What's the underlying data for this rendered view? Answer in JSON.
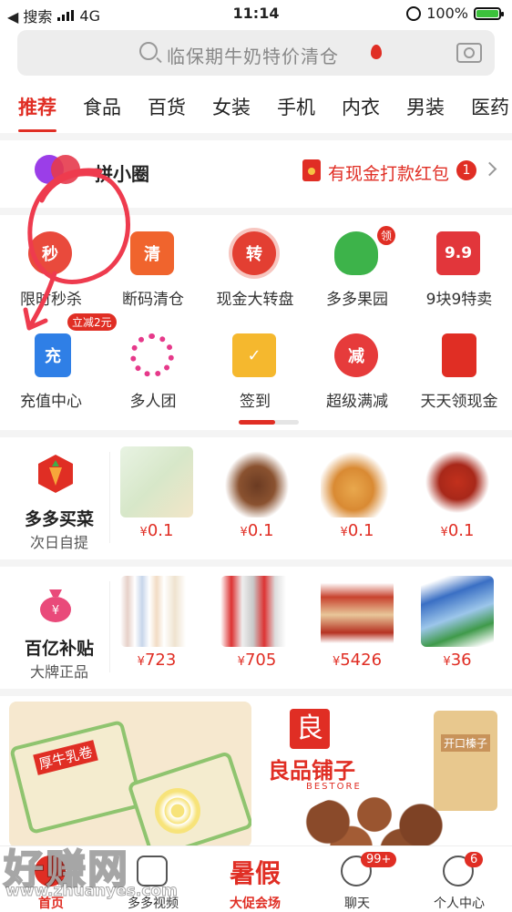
{
  "status": {
    "carrier": "◀ 搜索",
    "network": "4G",
    "time": "11:14",
    "battery": "100%"
  },
  "search": {
    "placeholder": "临保期牛奶特价清仓"
  },
  "categories": [
    "推荐",
    "食品",
    "百货",
    "女装",
    "手机",
    "内衣",
    "男装",
    "医药"
  ],
  "pin": {
    "title": "拼小圈",
    "promo": "有现金打款红包",
    "badge": "1"
  },
  "grid": [
    {
      "label": "限时秒杀",
      "icon": "alarm-clock-icon",
      "glyph": "秒",
      "color": "#e94a3c"
    },
    {
      "label": "断码清仓",
      "icon": "truck-icon",
      "glyph": "清",
      "color": "#f0642d"
    },
    {
      "label": "现金大转盘",
      "icon": "spin-wheel-icon",
      "glyph": "转",
      "color": "#e33f32"
    },
    {
      "label": "多多果园",
      "icon": "tree-icon",
      "glyph": "",
      "color": "#3db34a",
      "tag": "领"
    },
    {
      "label": "9块9特卖",
      "icon": "price-tag-icon",
      "glyph": "9.9",
      "color": "#e2363b"
    },
    {
      "label": "充值中心",
      "icon": "phone-recharge-icon",
      "glyph": "充",
      "color": "#2f7fe6",
      "tag": "立减2元"
    },
    {
      "label": "多人团",
      "icon": "group-icon",
      "glyph": "",
      "color": "#e6398a"
    },
    {
      "label": "签到",
      "icon": "calendar-check-icon",
      "glyph": "✓",
      "color": "#f5b82e"
    },
    {
      "label": "超级满减",
      "icon": "discount-icon",
      "glyph": "减",
      "color": "#e63b3b"
    },
    {
      "label": "天天领现金",
      "icon": "red-envelope-icon",
      "glyph": "",
      "color": "#e02e24"
    }
  ],
  "maicai": {
    "title": "多多买菜",
    "subtitle": "次日自提",
    "prices": [
      "0.1",
      "0.1",
      "0.1",
      "0.1"
    ]
  },
  "butie": {
    "title": "百亿补贴",
    "subtitle": "大牌正品",
    "prices": [
      "723",
      "705",
      "5426",
      "36"
    ]
  },
  "currency": "¥",
  "banner_right": {
    "brand": "良品铺子",
    "brand_en": "BESTORE",
    "pack_label": "开口榛子"
  },
  "banner_left": {
    "pack_label": "厚牛乳卷"
  },
  "tabs": [
    {
      "label": "首页",
      "active": true
    },
    {
      "label": "多多视频"
    },
    {
      "label": "大促会场",
      "big": "暑假"
    },
    {
      "label": "聊天",
      "badge": "99+"
    },
    {
      "label": "个人中心",
      "badge": "6"
    }
  ],
  "watermark": {
    "text": "好赚网",
    "url": "www.zhuanyes.com"
  },
  "colors": {
    "accent": "#e02e24"
  }
}
